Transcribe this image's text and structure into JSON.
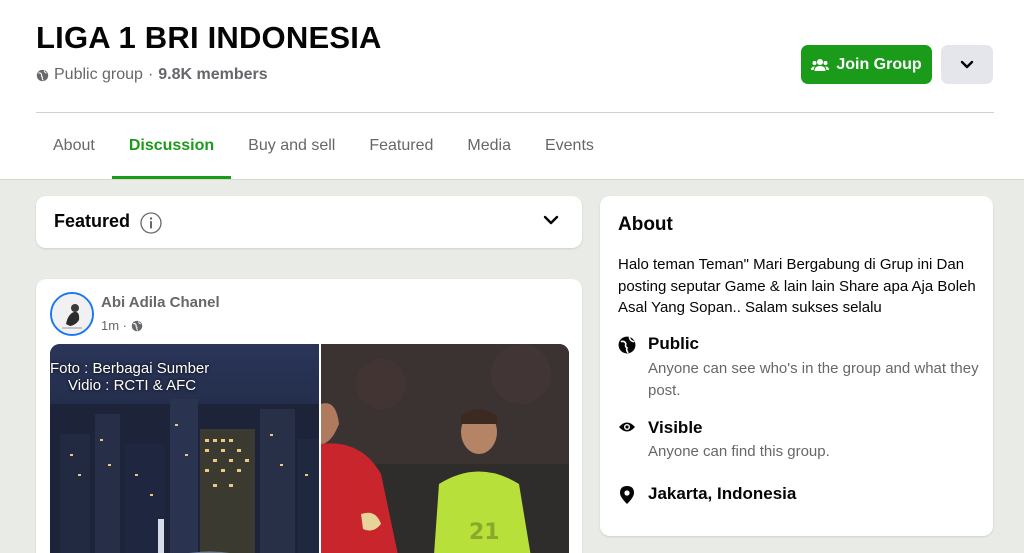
{
  "header": {
    "group_name": "LIGA 1 BRI INDONESIA",
    "privacy": "Public group",
    "separator": "·",
    "members": "9.8K members",
    "join_label": "Join Group"
  },
  "tabs": [
    {
      "label": "About"
    },
    {
      "label": "Discussion",
      "active": true
    },
    {
      "label": "Buy and sell"
    },
    {
      "label": "Featured"
    },
    {
      "label": "Media"
    },
    {
      "label": "Events"
    }
  ],
  "featured": {
    "label": "Featured"
  },
  "post": {
    "author": "Abi Adila Chanel",
    "time": "1m ·",
    "overlay_line1": "Foto : Berbagai Sumber",
    "overlay_line2": "Vidio : RCTI & AFC"
  },
  "about": {
    "title": "About",
    "description": "Halo teman Teman\" Mari Bergabung di Grup ini Dan posting seputar Game & lain lain Share apa Aja Boleh Asal Yang Sopan.. Salam sukses selalu",
    "public_title": "Public",
    "public_desc": "Anyone can see who's in the group and what they post.",
    "visible_title": "Visible",
    "visible_desc": "Anyone can find this group.",
    "location": "Jakarta, Indonesia"
  },
  "colors": {
    "accent": "#1a9b1a",
    "background": "#e9ece6",
    "muted_text": "#65676b"
  },
  "icons": [
    "globe-icon",
    "group-icon",
    "chevron-down-icon",
    "info-icon",
    "eye-icon",
    "location-pin-icon"
  ]
}
